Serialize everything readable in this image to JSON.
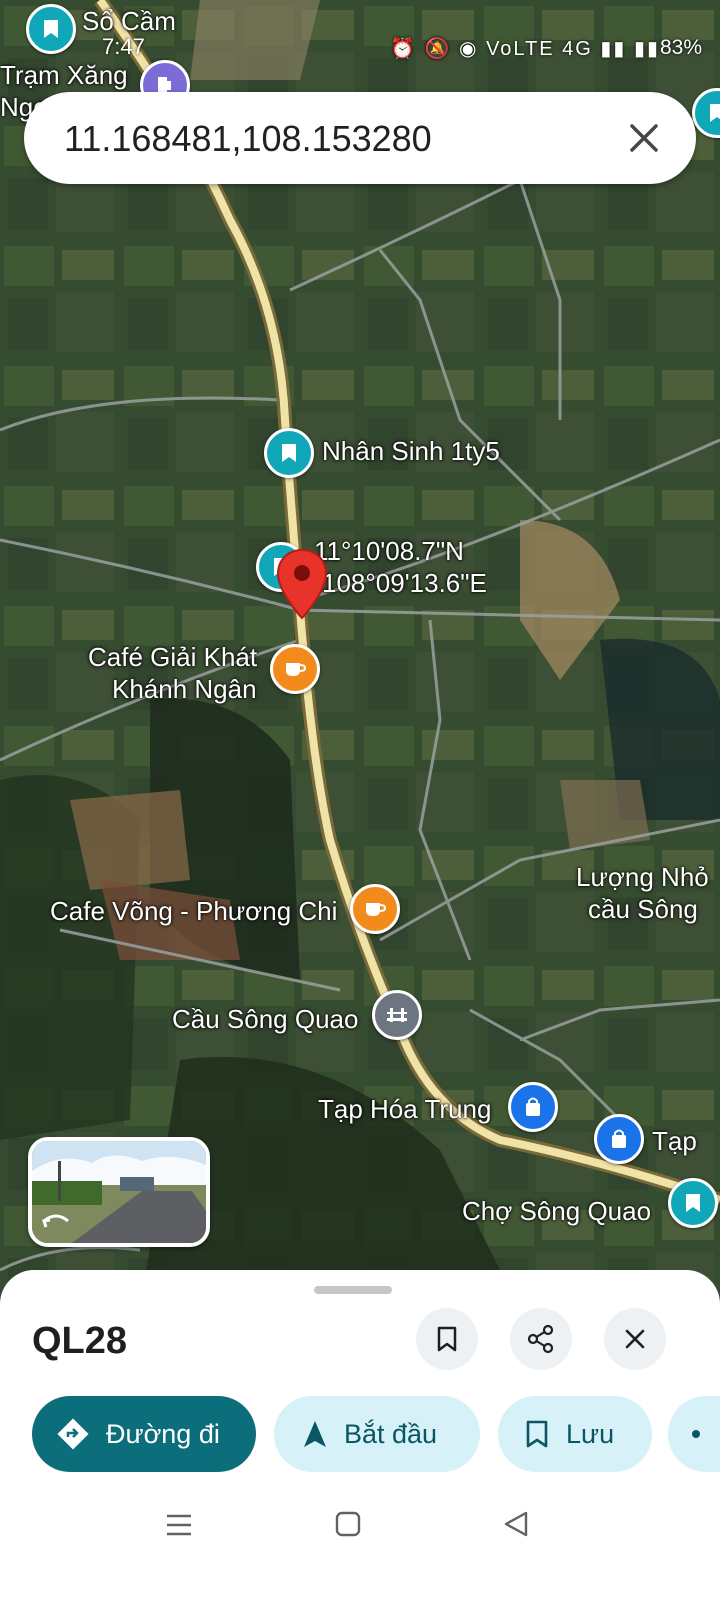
{
  "status_bar": {
    "time": "7:47",
    "indicators": "⏰ 🔕 ◉ VoLTE 4G ▮▮ ▮▮",
    "battery": "83%"
  },
  "search": {
    "value": "11.168481,108.153280"
  },
  "map_labels": {
    "so_cam": "Sổ Cầm",
    "tram_xang": "Trạm Xăng",
    "tram_xang_2": "Ngọ",
    "nhan_sinh": "Nhân Sinh 1ty5",
    "coord_lat": "11°10'08.7\"N",
    "coord_lng": "108°09'13.6\"E",
    "cafe_giai_khat_1": "Café Giải Khát",
    "cafe_giai_khat_2": "Khánh Ngân",
    "cafe_vong": "Cafe Võng - Phương Chi",
    "luong_nho_1": "Lượng Nhỏ",
    "luong_nho_2": "cầu Sông",
    "cau_song_quao": "Cầu Sông Quao",
    "tap_hoa_trung": "Tạp Hóa Trung",
    "tap_2": "Tạp",
    "cho_song_quao": "Chợ Sông Quao"
  },
  "place_sheet": {
    "title": "QL28",
    "buttons": {
      "directions": "Đường đi",
      "start": "Bắt đầu",
      "save": "Lưu"
    }
  },
  "colors": {
    "accent": "#0b6e7a",
    "chip_bg": "#d6f1f7",
    "pin_teal": "#10a7b8",
    "pin_orange": "#f28b1c",
    "red_pin": "#e8332a"
  },
  "icons": [
    "bookmark-icon",
    "share-icon",
    "close-icon",
    "directions-icon",
    "navigation-arrow-icon",
    "menu-icon",
    "home-square-icon",
    "back-triangle-icon"
  ]
}
